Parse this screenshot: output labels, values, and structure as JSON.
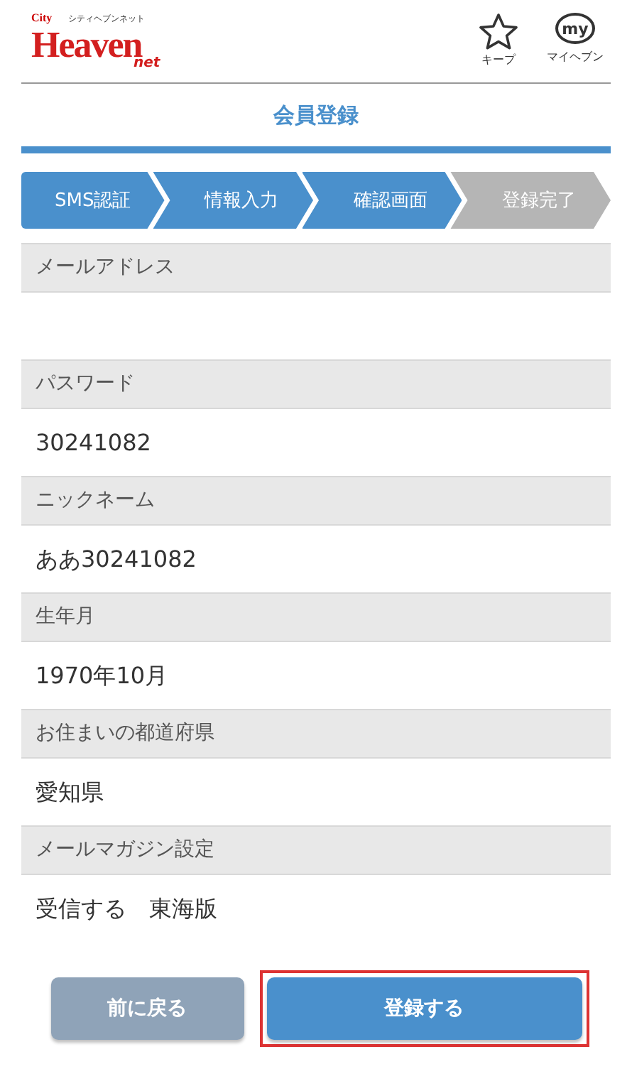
{
  "header": {
    "logo": {
      "small_top": "City",
      "main": "Heaven",
      "sub": "net",
      "kana": "シティヘブンネット"
    },
    "actions": [
      {
        "kind": "star",
        "label": "キープ"
      },
      {
        "kind": "my",
        "badge": "my",
        "label": "マイヘブン"
      }
    ]
  },
  "title": "会員登録",
  "steps": [
    {
      "label": "SMS認証",
      "done": true
    },
    {
      "label": "情報入力",
      "done": true
    },
    {
      "label": "確認画面",
      "done": true
    },
    {
      "label": "登録完了",
      "done": false
    }
  ],
  "fields": [
    {
      "label": "メールアドレス"
    },
    {
      "label": "パスワード",
      "value": "30241082"
    },
    {
      "label": "ニックネーム",
      "value": "ああ30241082"
    },
    {
      "label": "生年月",
      "value": "1970年10月"
    },
    {
      "label": "お住まいの都道府県",
      "value": "愛知県"
    },
    {
      "label": "メールマガジン設定",
      "value": "受信する　東海版"
    }
  ],
  "buttons": [
    {
      "kind": "back",
      "label": "前に戻る",
      "highlighted": false
    },
    {
      "kind": "submit",
      "label": "登録する",
      "highlighted": true
    }
  ]
}
